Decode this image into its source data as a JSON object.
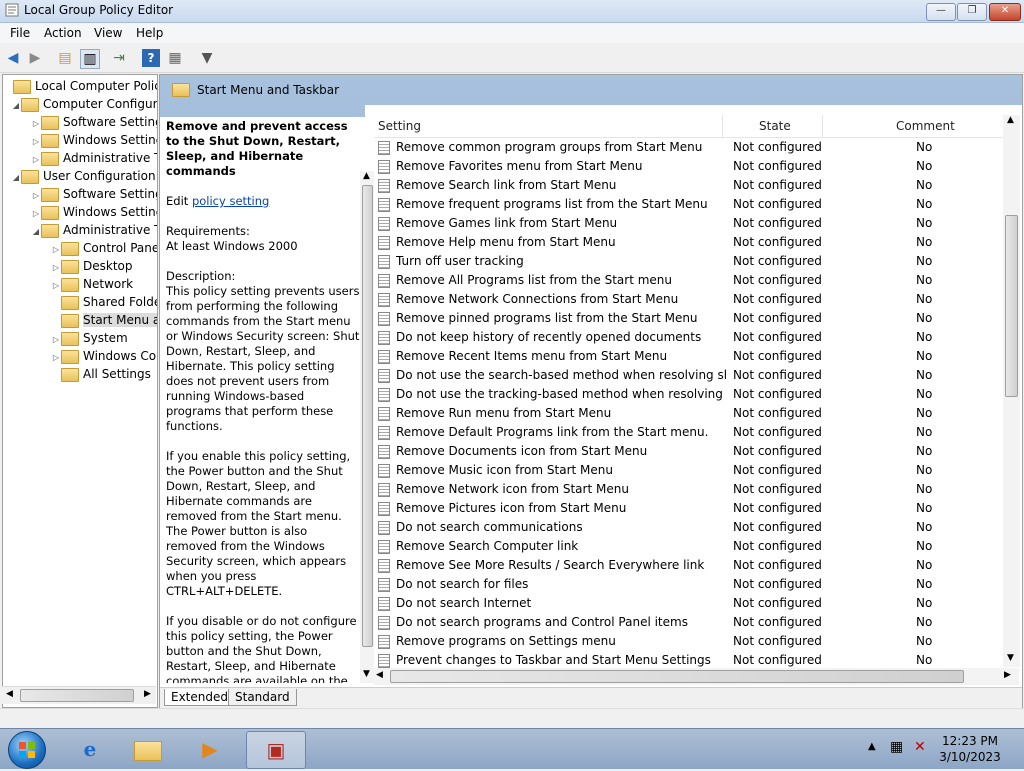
{
  "window": {
    "title": "Local Group Policy Editor",
    "controls": {
      "minimize": "—",
      "maximize": "❐",
      "close": "✕"
    }
  },
  "menu": [
    "File",
    "Action",
    "View",
    "Help"
  ],
  "tree": [
    {
      "label": "Local Computer Policy",
      "level": 0,
      "expander": ""
    },
    {
      "label": "Computer Configuration",
      "level": 1,
      "expander": "◢"
    },
    {
      "label": "Software Settings",
      "level": 2,
      "expander": "▷"
    },
    {
      "label": "Windows Settings",
      "level": 2,
      "expander": "▷"
    },
    {
      "label": "Administrative Templates",
      "level": 2,
      "expander": "▷"
    },
    {
      "label": "User Configuration",
      "level": 1,
      "expander": "◢"
    },
    {
      "label": "Software Settings",
      "level": 2,
      "expander": "▷"
    },
    {
      "label": "Windows Settings",
      "level": 2,
      "expander": "▷"
    },
    {
      "label": "Administrative Templates",
      "level": 2,
      "expander": "◢"
    },
    {
      "label": "Control Panel",
      "level": 3,
      "expander": "▷"
    },
    {
      "label": "Desktop",
      "level": 3,
      "expander": "▷"
    },
    {
      "label": "Network",
      "level": 3,
      "expander": "▷"
    },
    {
      "label": "Shared Folders",
      "level": 3,
      "expander": ""
    },
    {
      "label": "Start Menu and Taskbar",
      "level": 3,
      "expander": "",
      "selected": true
    },
    {
      "label": "System",
      "level": 3,
      "expander": "▷"
    },
    {
      "label": "Windows Components",
      "level": 3,
      "expander": "▷"
    },
    {
      "label": "All Settings",
      "level": 3,
      "expander": ""
    }
  ],
  "panel": {
    "header": "Start Menu and Taskbar",
    "description": {
      "title": "Remove and prevent access to the Shut Down, Restart, Sleep, and Hibernate commands",
      "edit_prefix": "Edit ",
      "edit_link": "policy setting ",
      "requirements_label": "Requirements:",
      "requirements_value": "At least Windows 2000",
      "description_label": "Description:",
      "description_text": "This policy setting prevents users from performing the following commands from the Start menu or Windows Security screen: Shut Down, Restart, Sleep, and Hibernate. This policy setting does not prevent users from running Windows-based programs that perform these functions.",
      "enable_text": "If you enable this policy setting, the Power button and the Shut Down, Restart, Sleep, and Hibernate commands are removed from the Start menu. The Power button is also removed from the Windows Security screen, which appears when you press CTRL+ALT+DELETE.",
      "disable_text": "If you disable or do not configure this policy setting, the Power button and the Shut Down, Restart, Sleep, and Hibernate commands are available on the Start menu. The Power button on the Windows Security screen is also available."
    },
    "columns": {
      "setting": "Setting",
      "state": "State",
      "comment": "Comment"
    },
    "rows": [
      {
        "setting": "Remove common program groups from Start Menu",
        "state": "Not configured",
        "comment": "No"
      },
      {
        "setting": "Remove Favorites menu from Start Menu",
        "state": "Not configured",
        "comment": "No"
      },
      {
        "setting": "Remove Search link from Start Menu",
        "state": "Not configured",
        "comment": "No"
      },
      {
        "setting": "Remove frequent programs list from the Start Menu",
        "state": "Not configured",
        "comment": "No"
      },
      {
        "setting": "Remove Games link from Start Menu",
        "state": "Not configured",
        "comment": "No"
      },
      {
        "setting": "Remove Help menu from Start Menu",
        "state": "Not configured",
        "comment": "No"
      },
      {
        "setting": "Turn off user tracking",
        "state": "Not configured",
        "comment": "No"
      },
      {
        "setting": "Remove All Programs list from the Start menu",
        "state": "Not configured",
        "comment": "No"
      },
      {
        "setting": "Remove Network Connections from Start Menu",
        "state": "Not configured",
        "comment": "No"
      },
      {
        "setting": "Remove pinned programs list from the Start Menu",
        "state": "Not configured",
        "comment": "No"
      },
      {
        "setting": "Do not keep history of recently opened documents",
        "state": "Not configured",
        "comment": "No"
      },
      {
        "setting": "Remove Recent Items menu from Start Menu",
        "state": "Not configured",
        "comment": "No"
      },
      {
        "setting": "Do not use the search-based method when resolving shell s...",
        "state": "Not configured",
        "comment": "No"
      },
      {
        "setting": "Do not use the tracking-based method when resolving shell ...",
        "state": "Not configured",
        "comment": "No"
      },
      {
        "setting": "Remove Run menu from Start Menu",
        "state": "Not configured",
        "comment": "No"
      },
      {
        "setting": "Remove Default Programs link from the Start menu.",
        "state": "Not configured",
        "comment": "No"
      },
      {
        "setting": "Remove Documents icon from Start Menu",
        "state": "Not configured",
        "comment": "No"
      },
      {
        "setting": "Remove Music icon from Start Menu",
        "state": "Not configured",
        "comment": "No"
      },
      {
        "setting": "Remove Network icon from Start Menu",
        "state": "Not configured",
        "comment": "No"
      },
      {
        "setting": "Remove Pictures icon from Start Menu",
        "state": "Not configured",
        "comment": "No"
      },
      {
        "setting": "Do not search communications",
        "state": "Not configured",
        "comment": "No"
      },
      {
        "setting": "Remove Search Computer link",
        "state": "Not configured",
        "comment": "No"
      },
      {
        "setting": "Remove See More Results / Search Everywhere link",
        "state": "Not configured",
        "comment": "No"
      },
      {
        "setting": "Do not search for files",
        "state": "Not configured",
        "comment": "No"
      },
      {
        "setting": "Do not search Internet",
        "state": "Not configured",
        "comment": "No"
      },
      {
        "setting": "Do not search programs and Control Panel items",
        "state": "Not configured",
        "comment": "No"
      },
      {
        "setting": "Remove programs on Settings menu",
        "state": "Not configured",
        "comment": "No"
      },
      {
        "setting": "Prevent changes to Taskbar and Start Menu Settings",
        "state": "Not configured",
        "comment": "No"
      }
    ],
    "tabs": [
      "Extended",
      "Standard"
    ]
  },
  "clock": {
    "time": "12:23 PM",
    "date": "3/10/2023"
  }
}
